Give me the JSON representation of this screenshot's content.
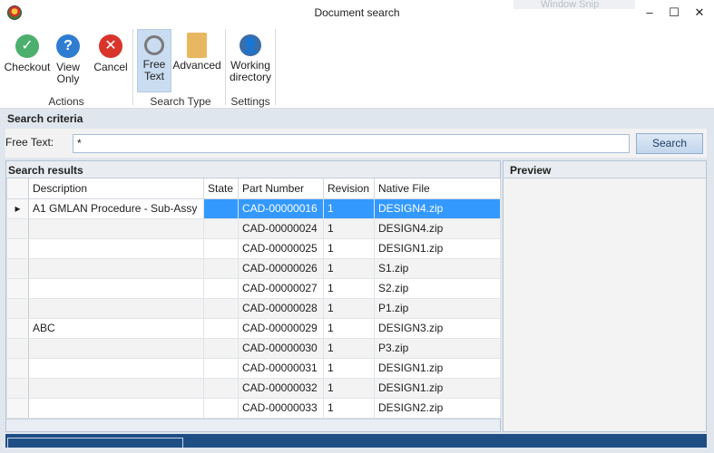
{
  "window": {
    "title": "Document search",
    "ghost_text": "Window Snip",
    "minimize": "–",
    "maximize": "☐",
    "close": "✕"
  },
  "ribbon": {
    "actions": {
      "checkout": "Checkout",
      "view_only_l1": "View",
      "view_only_l2": "Only",
      "cancel": "Cancel",
      "group_label": "Actions"
    },
    "search_type": {
      "free_text_l1": "Free",
      "free_text_l2": "Text",
      "advanced": "Advanced",
      "group_label": "Search Type"
    },
    "settings": {
      "working_dir_l1": "Working",
      "working_dir_l2": "directory",
      "group_label": "Settings"
    },
    "colors": {
      "checkout": "#4caf6d",
      "view_only": "#2f7dd1",
      "cancel": "#d9342b",
      "active_bg": "#c9dcf0"
    }
  },
  "search_criteria": {
    "header": "Search criteria",
    "free_text_label": "Free Text:",
    "free_text_value": "*",
    "search_button": "Search"
  },
  "results": {
    "header": "Search results",
    "columns": [
      "Description",
      "State",
      "Part Number",
      "Revision",
      "Native File"
    ],
    "rows": [
      {
        "marker": "▸",
        "description": "A1 GMLAN Procedure - Sub-Assy",
        "state": "",
        "part_number": "CAD-00000016",
        "revision": "1",
        "native_file": "DESIGN4.zip"
      },
      {
        "marker": "",
        "description": "",
        "state": "",
        "part_number": "CAD-00000024",
        "revision": "1",
        "native_file": "DESIGN4.zip"
      },
      {
        "marker": "",
        "description": "",
        "state": "",
        "part_number": "CAD-00000025",
        "revision": "1",
        "native_file": "DESIGN1.zip"
      },
      {
        "marker": "",
        "description": "",
        "state": "",
        "part_number": "CAD-00000026",
        "revision": "1",
        "native_file": "S1.zip"
      },
      {
        "marker": "",
        "description": "",
        "state": "",
        "part_number": "CAD-00000027",
        "revision": "1",
        "native_file": "S2.zip"
      },
      {
        "marker": "",
        "description": "",
        "state": "",
        "part_number": "CAD-00000028",
        "revision": "1",
        "native_file": "P1.zip"
      },
      {
        "marker": "",
        "description": "ABC",
        "state": "",
        "part_number": "CAD-00000029",
        "revision": "1",
        "native_file": "DESIGN3.zip"
      },
      {
        "marker": "",
        "description": "",
        "state": "",
        "part_number": "CAD-00000030",
        "revision": "1",
        "native_file": "P3.zip"
      },
      {
        "marker": "",
        "description": "",
        "state": "",
        "part_number": "CAD-00000031",
        "revision": "1",
        "native_file": "DESIGN1.zip"
      },
      {
        "marker": "",
        "description": "",
        "state": "",
        "part_number": "CAD-00000032",
        "revision": "1",
        "native_file": "DESIGN1.zip"
      },
      {
        "marker": "",
        "description": "",
        "state": "",
        "part_number": "CAD-00000033",
        "revision": "1",
        "native_file": "DESIGN2.zip"
      }
    ],
    "selected_row": 0,
    "selection_color": "#3399ff"
  },
  "preview": {
    "header": "Preview"
  }
}
